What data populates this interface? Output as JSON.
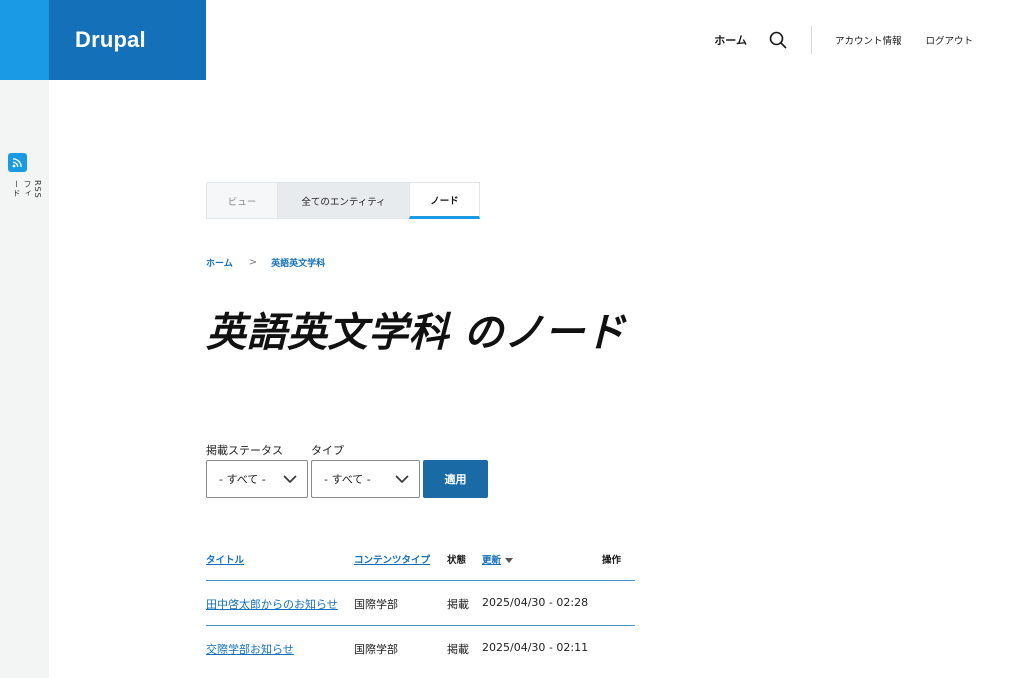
{
  "brand": {
    "logo_text": "Drupal"
  },
  "header": {
    "home": "ホーム",
    "account": "アカウント情報",
    "logout": "ログアウト"
  },
  "sidebar": {
    "rss_label": "RSSフィード"
  },
  "tabs": [
    {
      "label": "ビュー"
    },
    {
      "label": "全てのエンティティ"
    },
    {
      "label": "ノード",
      "active": true
    }
  ],
  "breadcrumb": {
    "home": "ホーム",
    "current": "英語英文学科"
  },
  "page_title": "英語英文学科 のノード",
  "filters": {
    "status_label": "掲載ステータス",
    "status_value": "- すべて -",
    "type_label": "タイプ",
    "type_value": "- すべて -",
    "apply_label": "適用"
  },
  "table": {
    "headers": {
      "title": "タイトル",
      "content_type": "コンテンツタイプ",
      "status": "状態",
      "updated": "更新",
      "operations": "操作"
    },
    "rows": [
      {
        "title": "田中啓太郎からのお知らせ",
        "content_type": "国際学部",
        "status": "掲載",
        "updated": "2025/04/30 - 02:28"
      },
      {
        "title": "交際学部お知らせ",
        "content_type": "国際学部",
        "status": "掲載",
        "updated": "2025/04/30 - 02:11"
      }
    ]
  },
  "colors": {
    "brand_blue": "#1470b8",
    "accent_blue": "#1b9ae4",
    "button_blue": "#1a6aa5"
  }
}
